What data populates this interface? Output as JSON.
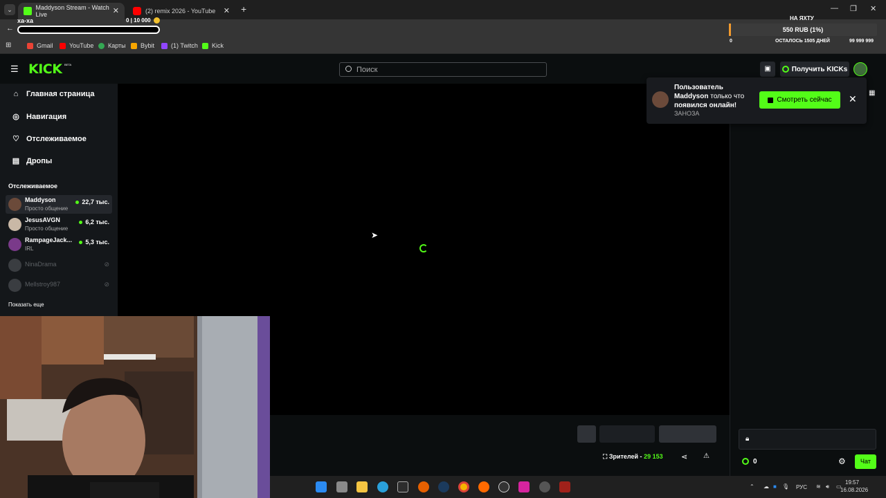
{
  "browser": {
    "tabs": [
      {
        "title": "Maddyson Stream - Watch Live",
        "active": true,
        "icon": "kick-favicon"
      },
      {
        "title": "(2) remix 2026 - YouTube",
        "active": false,
        "icon": "youtube-favicon"
      }
    ],
    "new_tab": "+",
    "bookmarks": [
      {
        "label": "Gmail",
        "icon": "gmail-icon",
        "color": "#ea4335"
      },
      {
        "label": "YouTube",
        "icon": "youtube-icon",
        "color": "#ff0000"
      },
      {
        "label": "Карты",
        "icon": "maps-icon",
        "color": "#34a853"
      },
      {
        "label": "Bybit",
        "icon": "bybit-icon",
        "color": "#f7a600"
      },
      {
        "label": "(1) Twitch",
        "icon": "twitch-icon",
        "color": "#9146ff"
      },
      {
        "label": "Kick",
        "icon": "kick-icon",
        "color": "#53fc18"
      }
    ]
  },
  "donation_overlay": {
    "left_label": "ха-ха",
    "counter": "0 | 10 000",
    "goal_title": "НА ЯХТУ",
    "goal_amount": "550 RUB (1%)",
    "goal_min": "0",
    "goal_remaining": "ОСТАЛОСЬ 1505 ДНЕЙ",
    "goal_max": "99 999 999",
    "goal_progress": 0.01
  },
  "kick": {
    "logo": "KICK",
    "logo_badge": "BETA",
    "search_placeholder": "Поиск",
    "get_kicks_label": "Получить KICKs",
    "nav": [
      {
        "label": "Главная страница",
        "icon": "home-icon"
      },
      {
        "label": "Навигация",
        "icon": "compass-icon"
      },
      {
        "label": "Отслеживаемое",
        "icon": "heart-icon"
      },
      {
        "label": "Дропы",
        "icon": "gift-icon"
      }
    ],
    "following_title": "Отслеживаемое",
    "following": [
      {
        "name": "Maddyson",
        "category": "Просто общение",
        "viewers": "22,7 тыс.",
        "live": true,
        "avatar_color": "#6b4a3a"
      },
      {
        "name": "JesusAVGN",
        "category": "Просто общение",
        "viewers": "6,2 тыс.",
        "live": true,
        "avatar_color": "#c9b8a6"
      },
      {
        "name": "RampageJack...",
        "category": "IRL",
        "viewers": "5,3 тыс.",
        "live": true,
        "avatar_color": "#7a3a8a"
      },
      {
        "name": "NinaDrama",
        "category": "",
        "viewers": "",
        "live": false,
        "avatar_color": "#3a3d41"
      },
      {
        "name": "Mellstroy987",
        "category": "",
        "viewers": "",
        "live": false,
        "avatar_color": "#3a3d41"
      }
    ],
    "show_more": "Показать еще",
    "notification": {
      "line1": "Пользователь",
      "line2_name": "Maddyson",
      "line2_rest": " только что",
      "line3": "появился онлайн!",
      "sub": "ЗАНОЗА",
      "button": "Смотреть сейчас"
    },
    "stream_info": {
      "viewers_label": "Зрителей -",
      "viewers_value": "29 153"
    },
    "chat": {
      "kicks_count": "0",
      "chat_button": "Чат"
    }
  },
  "taskbar": {
    "lang": "РУС",
    "time": "19:57",
    "date": "16.08.2026"
  }
}
